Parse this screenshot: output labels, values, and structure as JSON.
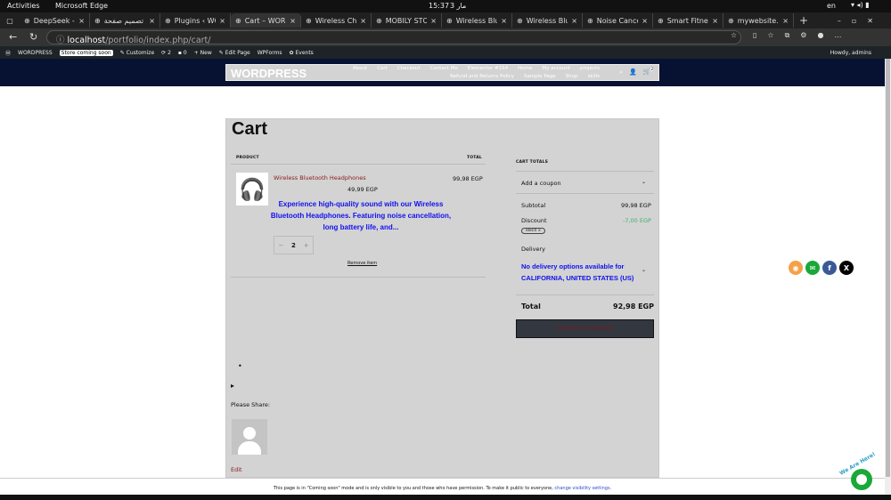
{
  "system": {
    "activities": "Activities",
    "app": "Microsoft Edge",
    "time": "15:37",
    "date": "3 مار",
    "lang": "en"
  },
  "tabs": [
    {
      "label": "DeepSeek - In"
    },
    {
      "label": "تصميم صفحة"
    },
    {
      "label": "Plugins ‹ WOR"
    },
    {
      "label": "Cart – WORD"
    },
    {
      "label": "Wireless Char"
    },
    {
      "label": "MOBILY STOR"
    },
    {
      "label": "Wireless Blue"
    },
    {
      "label": "Wireless Blue"
    },
    {
      "label": "Noise Cancell"
    },
    {
      "label": "Smart Fitness"
    },
    {
      "label": "mywebsite.co"
    }
  ],
  "active_tab": 3,
  "address": {
    "host": "localhost",
    "path": "/portfolio/index.php/cart/"
  },
  "adminbar": {
    "site": "WORDPRESS",
    "store_badge": "Store coming soon",
    "customize": "Customize",
    "updates": "2",
    "comments": "0",
    "new": "New",
    "edit": "Edit Page",
    "wpforms": "WPForms",
    "events": "Events",
    "howdy": "Howdy, admins"
  },
  "site": {
    "logo": "WORDPRESS",
    "menu1": [
      "About",
      "Cart",
      "Checkout",
      "Contact Me",
      "Elementor #154",
      "Home",
      "My account",
      "projects"
    ],
    "menu2": [
      "Refund and Returns Policy",
      "Sample Page",
      "Shop",
      "skills"
    ],
    "cart_count": "2"
  },
  "cart": {
    "title": "Cart",
    "col_product": "PRODUCT",
    "col_total": "TOTAL",
    "product_name": "Wireless Bluetooth Headphones",
    "unit_price": "49,99 EGP",
    "line_total": "99,98 EGP",
    "description": "Experience high-quality sound with our Wireless Bluetooth Headphones. Featuring noise cancellation, long battery life, and...",
    "qty": "2",
    "minus": "−",
    "plus": "+",
    "remove": "Remove item"
  },
  "totals": {
    "heading": "CART TOTALS",
    "coupon": "Add a coupon",
    "subtotal_label": "Subtotal",
    "subtotal": "99,98 EGP",
    "discount_label": "Discount",
    "discount": "-7,00 EGP",
    "coupon_code": "elec4",
    "delivery_label": "Delivery",
    "delivery_msg": "No delivery options available for CALIFORNIA, UNITED STATES (US)",
    "total_label": "Total",
    "total": "92,98 EGP",
    "checkout": "Proceed to Checkout"
  },
  "extra": {
    "bullet": "•",
    "arrow": "▸",
    "share": "Please Share:",
    "edit": "Edit"
  },
  "notice": {
    "text": "This page is in \"Coming soon\" mode and is only visible to you and those who have permission. To make it public to everyone,",
    "link": "change visibility settings."
  },
  "chat": {
    "label": "We Are Here!"
  },
  "colors": {
    "header": "#071233",
    "box": "#d3d3d3",
    "discount": "#3cb371",
    "blue": "#1010f0"
  }
}
